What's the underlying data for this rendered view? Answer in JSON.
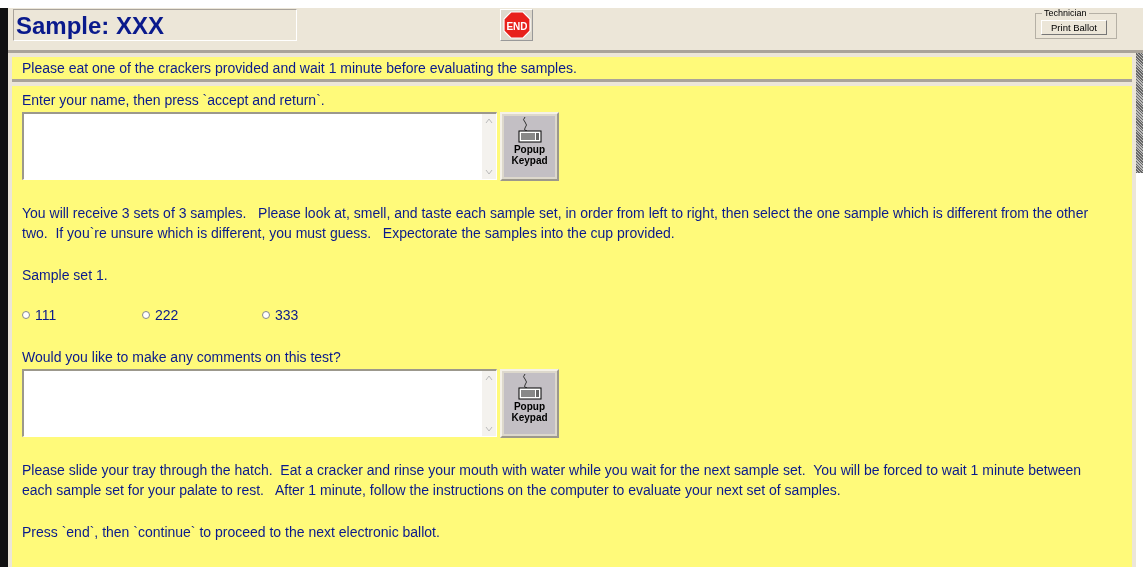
{
  "title": "Sample: XXX",
  "end_button": {
    "label": "END"
  },
  "technician": {
    "label": "Technician",
    "button": "Print Ballot"
  },
  "notice": "Please eat one of the crackers provided and wait 1 minute before evaluating the samples.",
  "name_prompt": "Enter your name, then press `accept and return`.",
  "name_keypad": "Popup Keypad",
  "instructions": "You will receive 3 sets of 3 samples.   Please look at, smell, and taste each sample set, in order from left to right, then select the one sample which is different from the other two.  If you`re unsure which is different, you must guess.   Expectorate the samples into the cup provided.",
  "sample_set": "Sample set 1.",
  "options": [
    {
      "label": "111",
      "selected": false
    },
    {
      "label": "222",
      "selected": false
    },
    {
      "label": "333",
      "selected": false
    }
  ],
  "comment_prompt": "Would you like to make any comments on this test?",
  "comment_keypad": "Popup Keypad",
  "after_text": "Please slide your tray through the hatch.  Eat a cracker and rinse your mouth with water while you wait for the next sample set.  You will be forced to wait 1 minute between each sample set for your palate to rest.   After 1 minute, follow the instructions on the computer to evaluate your next set of samples.",
  "final_text": "Press `end`, then `continue` to proceed to the next electronic ballot."
}
